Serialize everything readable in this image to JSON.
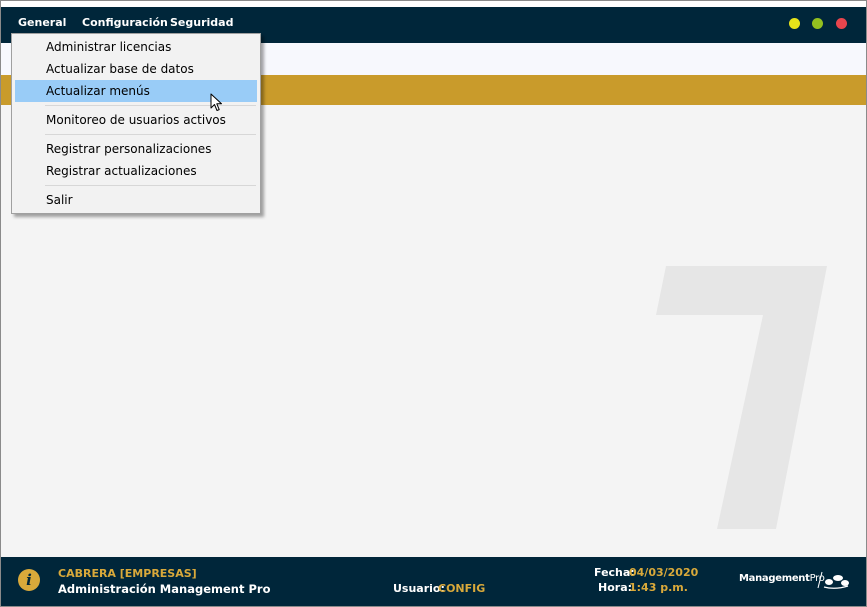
{
  "menubar": {
    "items": [
      {
        "label": "General"
      },
      {
        "label": "Configuración"
      },
      {
        "label": "Seguridad"
      }
    ],
    "window_controls": {
      "minimize_color": "#e6e21a",
      "maximize_color": "#93c01f",
      "close_color": "#e8454d"
    }
  },
  "dropdown": {
    "items": [
      {
        "label": "Administrar licencias"
      },
      {
        "label": "Actualizar base de datos"
      },
      {
        "label": "Actualizar menús",
        "highlighted": true
      },
      {
        "label": "Monitoreo de usuarios activos"
      },
      {
        "label": "Registrar personalizaciones"
      },
      {
        "label": "Registrar actualizaciones"
      },
      {
        "label": "Salir"
      }
    ]
  },
  "status": {
    "company": "CABRERA [EMPRESAS]",
    "app_name": "Administración Management Pro",
    "user_label": "Usuario:",
    "user_value": "CONFIG",
    "date_label": "Fecha:",
    "date_value": "04/03/2020",
    "time_label": "Hora:",
    "time_value": "1:43 p.m.",
    "info_glyph": "i",
    "brand_bold": "Management",
    "brand_light": "Pro"
  },
  "colors": {
    "navy": "#00263a",
    "gold": "#c99b2b",
    "gold_text": "#d9a93a",
    "highlight": "#99ccf7",
    "background": "#f4f4f4"
  },
  "icons": {
    "info": "info-icon",
    "cursor": "pointer-cursor-icon",
    "brand_logo": "managementpro-logo-icon"
  }
}
